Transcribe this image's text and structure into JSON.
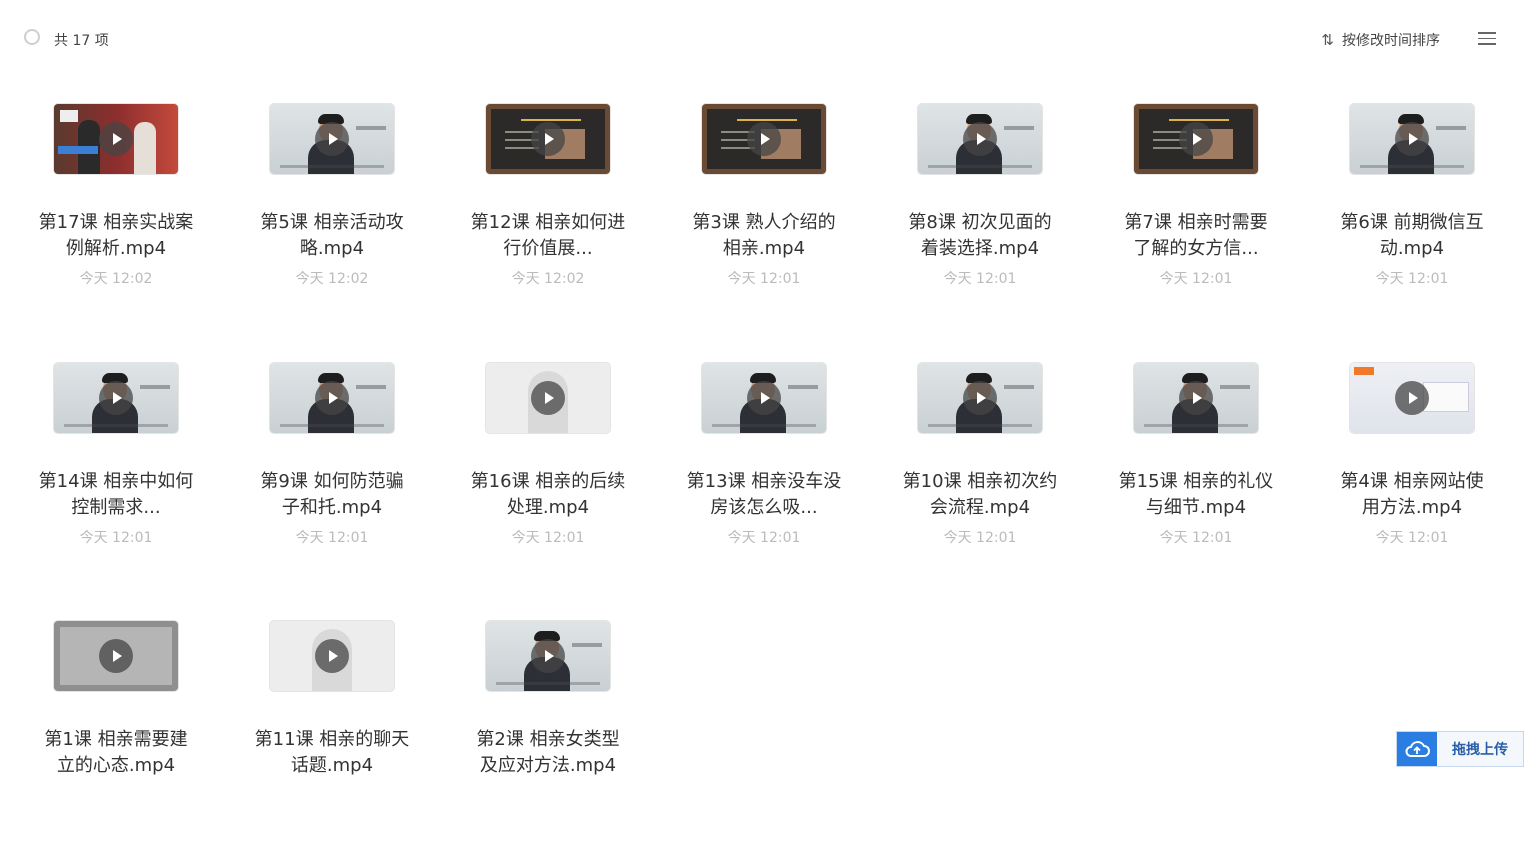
{
  "header": {
    "count_text": "共 17 项",
    "sort_label": "按修改时间排序"
  },
  "upload": {
    "label": "拖拽上传"
  },
  "files": [
    {
      "name": "第17课 相亲实战案例解析.mp4",
      "time": "今天 12:02",
      "thumb": "studio"
    },
    {
      "name": "第5课 相亲活动攻略.mp4",
      "time": "今天 12:02",
      "thumb": "person"
    },
    {
      "name": "第12课 相亲如何进行价值展...",
      "time": "今天 12:02",
      "thumb": "board"
    },
    {
      "name": "第3课 熟人介绍的相亲.mp4",
      "time": "今天 12:01",
      "thumb": "board"
    },
    {
      "name": "第8课 初次见面的着装选择.mp4",
      "time": "今天 12:01",
      "thumb": "person"
    },
    {
      "name": "第7课 相亲时需要了解的女方信...",
      "time": "今天 12:01",
      "thumb": "board"
    },
    {
      "name": "第6课 前期微信互动.mp4",
      "time": "今天 12:01",
      "thumb": "person"
    },
    {
      "name": "第14课 相亲中如何控制需求...",
      "time": "今天 12:01",
      "thumb": "person"
    },
    {
      "name": "第9课 如何防范骗子和托.mp4",
      "time": "今天 12:01",
      "thumb": "person"
    },
    {
      "name": "第16课 相亲的后续处理.mp4",
      "time": "今天 12:01",
      "thumb": "faded"
    },
    {
      "name": "第13课 相亲没车没房该怎么吸...",
      "time": "今天 12:01",
      "thumb": "person"
    },
    {
      "name": "第10课 相亲初次约会流程.mp4",
      "time": "今天 12:01",
      "thumb": "person"
    },
    {
      "name": "第15课 相亲的礼仪与细节.mp4",
      "time": "今天 12:01",
      "thumb": "person"
    },
    {
      "name": "第4课 相亲网站使用方法.mp4",
      "time": "今天 12:01",
      "thumb": "site"
    },
    {
      "name": "第1课 相亲需要建立的心态.mp4",
      "time": "",
      "thumb": "dark"
    },
    {
      "name": "第11课 相亲的聊天话题.mp4",
      "time": "",
      "thumb": "faded"
    },
    {
      "name": "第2课 相亲女类型及应对方法.mp4",
      "time": "",
      "thumb": "person"
    }
  ]
}
